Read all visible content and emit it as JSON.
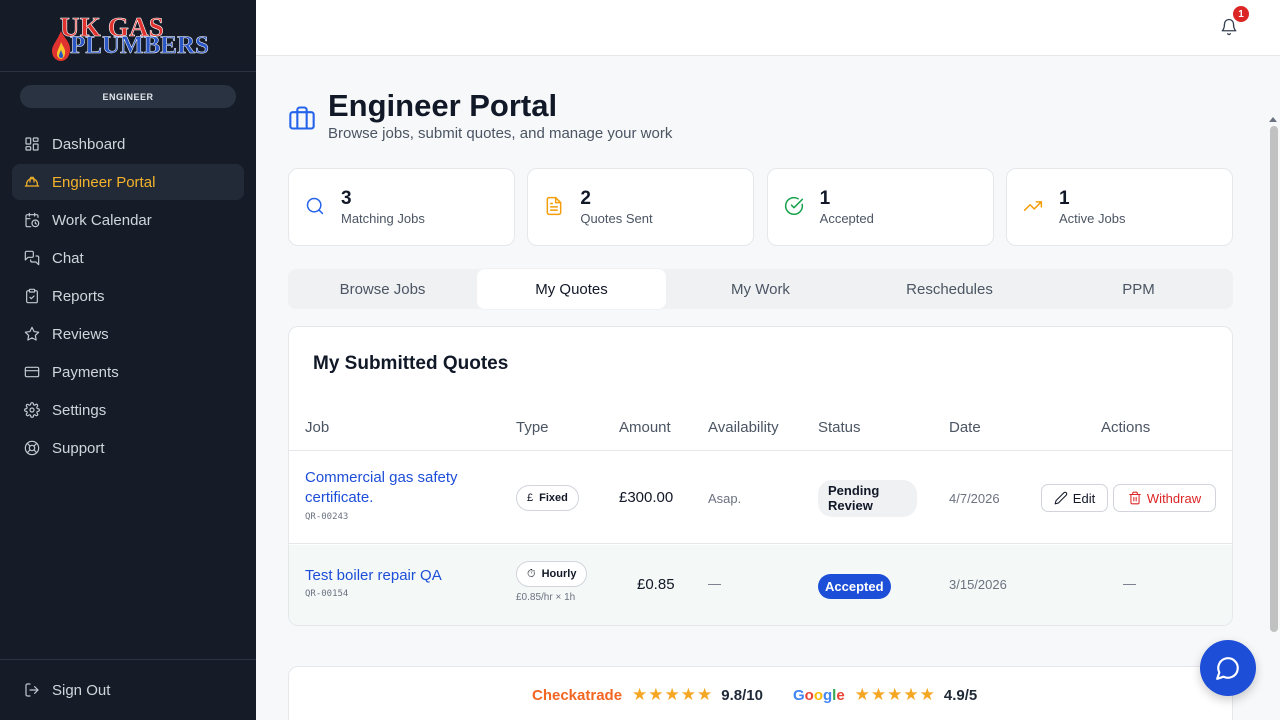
{
  "brand": {
    "line1": "UK GAS",
    "line2": "PLUMBERS"
  },
  "role_badge": "ENGINEER",
  "sidebar": {
    "items": [
      {
        "label": "Dashboard",
        "icon": "dashboard-icon"
      },
      {
        "label": "Engineer Portal",
        "icon": "hard-hat-icon",
        "active": true
      },
      {
        "label": "Work Calendar",
        "icon": "calendar-clock-icon"
      },
      {
        "label": "Chat",
        "icon": "chat-icon"
      },
      {
        "label": "Reports",
        "icon": "clipboard-icon"
      },
      {
        "label": "Reviews",
        "icon": "star-icon"
      },
      {
        "label": "Payments",
        "icon": "credit-card-icon"
      },
      {
        "label": "Settings",
        "icon": "gear-icon"
      },
      {
        "label": "Support",
        "icon": "lifebuoy-icon"
      }
    ],
    "sign_out": "Sign Out"
  },
  "topbar": {
    "notifications_count": "1"
  },
  "header": {
    "title": "Engineer Portal",
    "subtitle": "Browse jobs, submit quotes, and manage your work"
  },
  "stats": [
    {
      "value": "3",
      "label": "Matching Jobs",
      "icon": "search-icon",
      "color": "#2563eb"
    },
    {
      "value": "2",
      "label": "Quotes Sent",
      "icon": "document-icon",
      "color": "#f59e0b"
    },
    {
      "value": "1",
      "label": "Accepted",
      "icon": "check-circle-icon",
      "color": "#16a34a"
    },
    {
      "value": "1",
      "label": "Active Jobs",
      "icon": "trending-up-icon",
      "color": "#f59e0b"
    }
  ],
  "tabs": [
    {
      "label": "Browse Jobs"
    },
    {
      "label": "My Quotes",
      "active": true
    },
    {
      "label": "My Work"
    },
    {
      "label": "Reschedules"
    },
    {
      "label": "PPM"
    }
  ],
  "quotes": {
    "title": "My Submitted Quotes",
    "columns": [
      "Job",
      "Type",
      "Amount",
      "Availability",
      "Status",
      "Date",
      "Actions"
    ],
    "rows": [
      {
        "job": "Commercial gas safety certificate.",
        "ref": "QR-00243",
        "type_icon": "£",
        "type": "Fixed",
        "amount": "£300.00",
        "availability": "Asap.",
        "status": "Pending Review",
        "date": "4/7/2026",
        "edit_label": "Edit",
        "withdraw_label": "Withdraw"
      },
      {
        "job": "Test boiler repair QA",
        "ref": "QR-00154",
        "type_icon": "⏱",
        "type": "Hourly",
        "type_detail": "£0.85/hr × 1h",
        "amount": "£0.85",
        "availability": "—",
        "status": "Accepted",
        "date": "3/15/2026",
        "actions": "—"
      }
    ]
  },
  "reviews": {
    "checkatrade_label": "Checkatrade",
    "checkatrade_stars": "★★★★★",
    "checkatrade_score": "9.8/10",
    "google_label": "Google",
    "google_stars": "★★★★★",
    "google_score": "4.9/5"
  },
  "colors": {
    "accent": "#1d4ed8",
    "sidebar_bg": "#151c28",
    "active_nav": "#f5b32b",
    "danger": "#dc2626"
  }
}
